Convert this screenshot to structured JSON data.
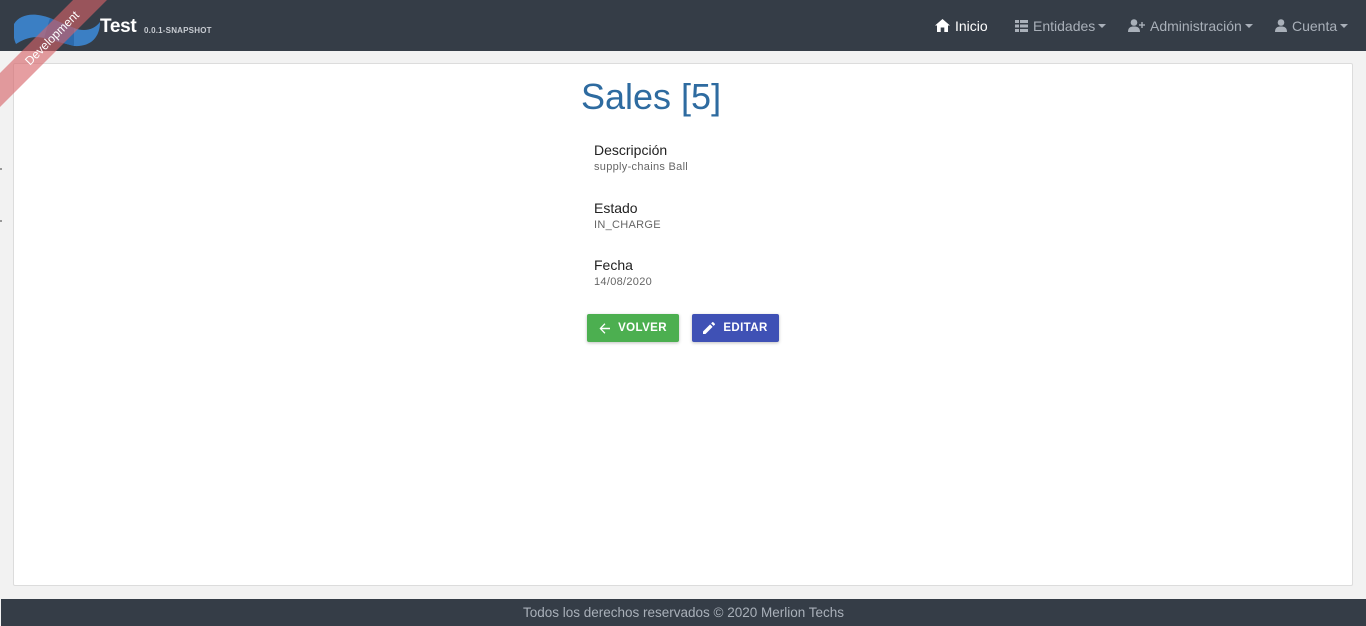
{
  "navbar": {
    "brand_title": "Test",
    "brand_version": "0.0.1-SNAPSHOT",
    "ribbon": "Development",
    "items": [
      {
        "label": "Inicio",
        "icon": "home-icon"
      },
      {
        "label": "Entidades",
        "icon": "table-icon"
      },
      {
        "label": "Administración",
        "icon": "user-plus-icon"
      },
      {
        "label": "Cuenta",
        "icon": "user-icon"
      }
    ]
  },
  "page": {
    "title": "Sales [5]",
    "fields": [
      {
        "label": "Descripción",
        "value": "supply-chains Ball"
      },
      {
        "label": "Estado",
        "value": "IN_CHARGE"
      },
      {
        "label": "Fecha",
        "value": "14/08/2020"
      }
    ],
    "buttons": {
      "back_label": "VOLVER",
      "edit_label": "EDITAR"
    }
  },
  "footer": {
    "text": "Todos los derechos reservados © 2020 Merlion Techs"
  },
  "colors": {
    "navbar_bg": "#353d47",
    "title": "#2e6ba0",
    "back_button": "#4caf50",
    "edit_button": "#3f51b5"
  }
}
